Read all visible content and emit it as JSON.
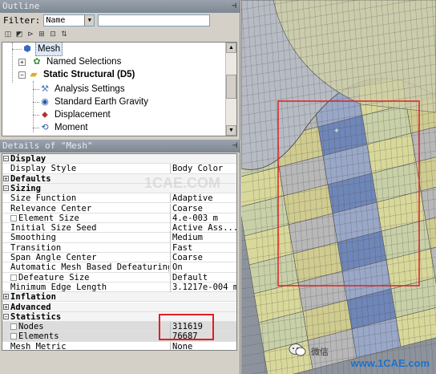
{
  "outline": {
    "title": "Outline",
    "filter_label": "Filter:",
    "filter_value": "Name",
    "tree": [
      {
        "label": "Mesh",
        "icon": "mesh-icon"
      },
      {
        "label": "Named Selections",
        "icon": "named-selections-icon"
      },
      {
        "label": "Static Structural (D5)",
        "icon": "static-structural-icon"
      },
      {
        "label": "Analysis Settings",
        "icon": "analysis-settings-icon"
      },
      {
        "label": "Standard Earth Gravity",
        "icon": "gravity-icon"
      },
      {
        "label": "Displacement",
        "icon": "displacement-icon"
      },
      {
        "label": "Moment",
        "icon": "moment-icon"
      }
    ]
  },
  "details": {
    "title": "Details of \"Mesh\"",
    "rows": [
      {
        "k": "Display",
        "v": "",
        "type": "cat",
        "mark": "-"
      },
      {
        "k": "Display Style",
        "v": "Body Color",
        "type": "prop"
      },
      {
        "k": "Defaults",
        "v": "",
        "type": "cat",
        "mark": "+"
      },
      {
        "k": "Sizing",
        "v": "",
        "type": "cat",
        "mark": "-"
      },
      {
        "k": "Size Function",
        "v": "Adaptive",
        "type": "prop"
      },
      {
        "k": "Relevance Center",
        "v": "Coarse",
        "type": "prop"
      },
      {
        "k": "Element Size",
        "v": "4.e-003 m",
        "type": "sub"
      },
      {
        "k": "Initial Size Seed",
        "v": "Active Ass...",
        "type": "prop"
      },
      {
        "k": "Smoothing",
        "v": "Medium",
        "type": "prop"
      },
      {
        "k": "Transition",
        "v": "Fast",
        "type": "prop"
      },
      {
        "k": "Span Angle Center",
        "v": "Coarse",
        "type": "prop"
      },
      {
        "k": "Automatic Mesh Based Defeaturing",
        "v": "On",
        "type": "prop"
      },
      {
        "k": "Defeature Size",
        "v": "Default",
        "type": "sub"
      },
      {
        "k": "Minimum Edge Length",
        "v": "3.1217e-004 m",
        "type": "prop"
      },
      {
        "k": "Inflation",
        "v": "",
        "type": "cat",
        "mark": "+"
      },
      {
        "k": "Advanced",
        "v": "",
        "type": "cat",
        "mark": "+"
      },
      {
        "k": "Statistics",
        "v": "",
        "type": "cat",
        "mark": "-"
      },
      {
        "k": "Nodes",
        "v": "311619",
        "type": "sub",
        "hl": true
      },
      {
        "k": "Elements",
        "v": "76687",
        "type": "sub",
        "hl": true
      },
      {
        "k": "Mesh Metric",
        "v": "None",
        "type": "prop"
      }
    ]
  },
  "watermark": {
    "wechat_text": "微信",
    "site": "www.1CAE.com",
    "faint": "1CAE.COM"
  },
  "colors": {
    "highlight_box": "#e02020",
    "mesh_yellow": "#d8d89a",
    "mesh_blue": "#6f86b8",
    "mesh_grey": "#b8b8b8"
  }
}
